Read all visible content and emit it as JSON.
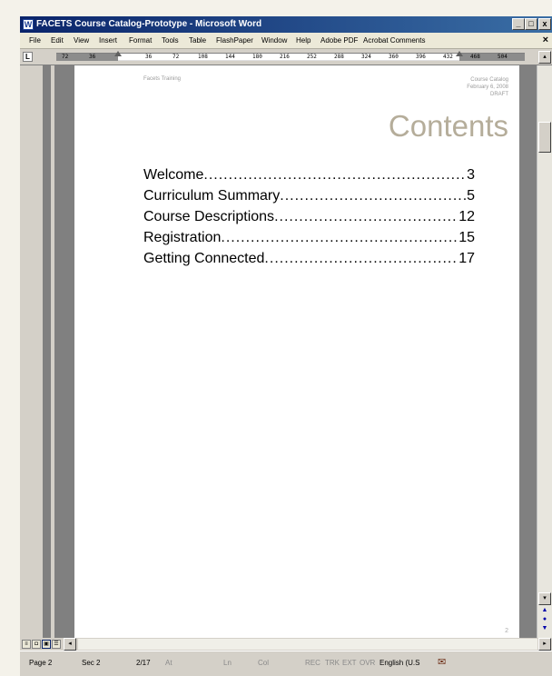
{
  "window": {
    "title": "FACETS Course Catalog-Prototype - Microsoft Word",
    "controls": {
      "minimize": "_",
      "restore": "□",
      "close": "x"
    }
  },
  "menu": {
    "items": [
      "File",
      "Edit",
      "View",
      "Insert",
      "Format",
      "Tools",
      "Table",
      "FlashPaper",
      "Window",
      "Help",
      "Adobe PDF",
      "Acrobat Comments"
    ],
    "close_doc": "×"
  },
  "ruler": {
    "corner": "L",
    "ticks": [
      "72",
      "36",
      "",
      "36",
      "72",
      "108",
      "144",
      "180",
      "216",
      "252",
      "288",
      "324",
      "360",
      "396",
      "432",
      "468",
      "504"
    ]
  },
  "document": {
    "header_left": "Facets Training",
    "header_right": [
      "Course Catalog",
      "February 6, 2008",
      "DRAFT"
    ],
    "heading": "Contents",
    "toc": [
      {
        "label": "Welcome",
        "page": "3"
      },
      {
        "label": "Curriculum Summary",
        "page": "5"
      },
      {
        "label": "Course Descriptions",
        "page": "12"
      },
      {
        "label": "Registration",
        "page": "15"
      },
      {
        "label": "Getting Connected",
        "page": "17"
      }
    ],
    "footer_page": "2"
  },
  "statusbar": {
    "page": "Page 2",
    "section": "Sec 2",
    "count": "2/17",
    "at": "At",
    "ln": "Ln",
    "col": "Col",
    "rec": "REC",
    "trk": "TRK",
    "ext": "EXT",
    "ovr": "OVR",
    "language": "English (U.S"
  },
  "colors": {
    "title_gradient_start": "#0a246a",
    "heading": "#b5ad9a",
    "chrome": "#d4d0c8"
  }
}
